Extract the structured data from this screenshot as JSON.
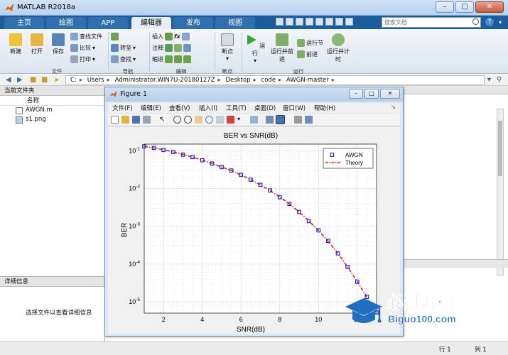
{
  "app": {
    "title": "MATLAB R2018a"
  },
  "window_buttons": [
    "–",
    "□",
    "✕"
  ],
  "tabs": [
    {
      "label": "主页"
    },
    {
      "label": "绘图"
    },
    {
      "label": "APP"
    },
    {
      "label": "编辑器"
    },
    {
      "label": "发布"
    },
    {
      "label": "视图"
    }
  ],
  "search": {
    "placeholder": "搜索文档"
  },
  "help_glyph": "?",
  "ribbon": {
    "new": "新建",
    "open": "打开",
    "save": "保存",
    "find_files": "查找文件",
    "compare": "比较",
    "print": "打印",
    "insert": "插入",
    "comment": "注释",
    "indent": "缩进",
    "goto": "转至",
    "find": "查找",
    "breakpoints": "断点",
    "run": "运行",
    "run_advance": "运行并前进",
    "run_section": "运行节",
    "advance": "前进",
    "run_time": "运行并计时",
    "groups": {
      "file": "文件",
      "nav": "导航",
      "edit": "编辑",
      "breakpoints": "断点",
      "run": "运行"
    }
  },
  "address": {
    "crumbs": [
      "C:",
      "Users",
      "Administrator.WIN7U-20180127Z",
      "Desktop",
      "code",
      "AWGN-master"
    ]
  },
  "left_panel": {
    "title": "当前文件夹",
    "column": "名称",
    "files": [
      {
        "name": "AWGN.m"
      },
      {
        "name": "s1.png"
      }
    ]
  },
  "detail_panel": {
    "title": "详细信息",
    "hint": "选择文件以查看详细信息"
  },
  "status": {
    "row": "行 1",
    "col": "列 1"
  },
  "figure": {
    "title": "Figure 1",
    "menu": [
      "文件(F)",
      "编辑(E)",
      "查看(V)",
      "插入(I)",
      "工具(T)",
      "桌面(D)",
      "窗口(W)",
      "帮助(H)"
    ]
  },
  "watermark": {
    "text": "必过源码",
    "url": "Biguo100.com"
  },
  "chart_data": {
    "type": "line",
    "title": "BER vs SNR(dB)",
    "xlabel": "SNR(dB)",
    "ylabel": "BER",
    "xlim": [
      1,
      13
    ],
    "ylim": [
      5e-06,
      0.15
    ],
    "yscale": "log",
    "grid": true,
    "legend_position": "top-right",
    "xticks": [
      2,
      4,
      6,
      8,
      10,
      12
    ],
    "yticks": [
      {
        "value": 0.1,
        "mant": "10",
        "exp": "-1"
      },
      {
        "value": 0.01,
        "mant": "10",
        "exp": "-2"
      },
      {
        "value": 0.001,
        "mant": "10",
        "exp": "-3"
      },
      {
        "value": 0.0001,
        "mant": "10",
        "exp": "-4"
      },
      {
        "value": 1e-05,
        "mant": "10",
        "exp": "-5"
      }
    ],
    "series": [
      {
        "name": "AWGN",
        "style": "markers",
        "color": "#1a1ad8",
        "x": [
          1,
          1.5,
          2,
          2.5,
          3,
          3.5,
          4,
          4.5,
          5,
          5.5,
          6,
          6.5,
          7,
          7.5,
          8,
          8.5,
          9,
          9.5,
          10,
          10.5,
          11,
          11.5,
          12,
          12.5,
          13
        ],
        "y": [
          0.131,
          0.119,
          0.105,
          0.093,
          0.079,
          0.068,
          0.056,
          0.046,
          0.037,
          0.03,
          0.023,
          0.0171,
          0.0125,
          0.0089,
          0.0059,
          0.0039,
          0.0024,
          0.00137,
          0.00078,
          0.00041,
          0.000191,
          8.4e-05,
          3.4e-05,
          1.35e-05,
          5.2e-06
        ]
      },
      {
        "name": "Theory",
        "style": "dash-dot",
        "color": "#e02020",
        "x": [
          1,
          1.5,
          2,
          2.5,
          3,
          3.5,
          4,
          4.5,
          5,
          5.5,
          6,
          6.5,
          7,
          7.5,
          8,
          8.5,
          9,
          9.5,
          10,
          10.5,
          11,
          11.5,
          12,
          12.5,
          13
        ],
        "y": [
          0.131,
          0.119,
          0.106,
          0.093,
          0.08,
          0.068,
          0.056,
          0.046,
          0.037,
          0.03,
          0.0229,
          0.0172,
          0.0125,
          0.0088,
          0.006,
          0.0039,
          0.0024,
          0.00139,
          0.00077,
          0.0004,
          0.000193,
          8.5e-05,
          3.4e-05,
          1.34e-05,
          5.1e-06
        ]
      }
    ]
  }
}
